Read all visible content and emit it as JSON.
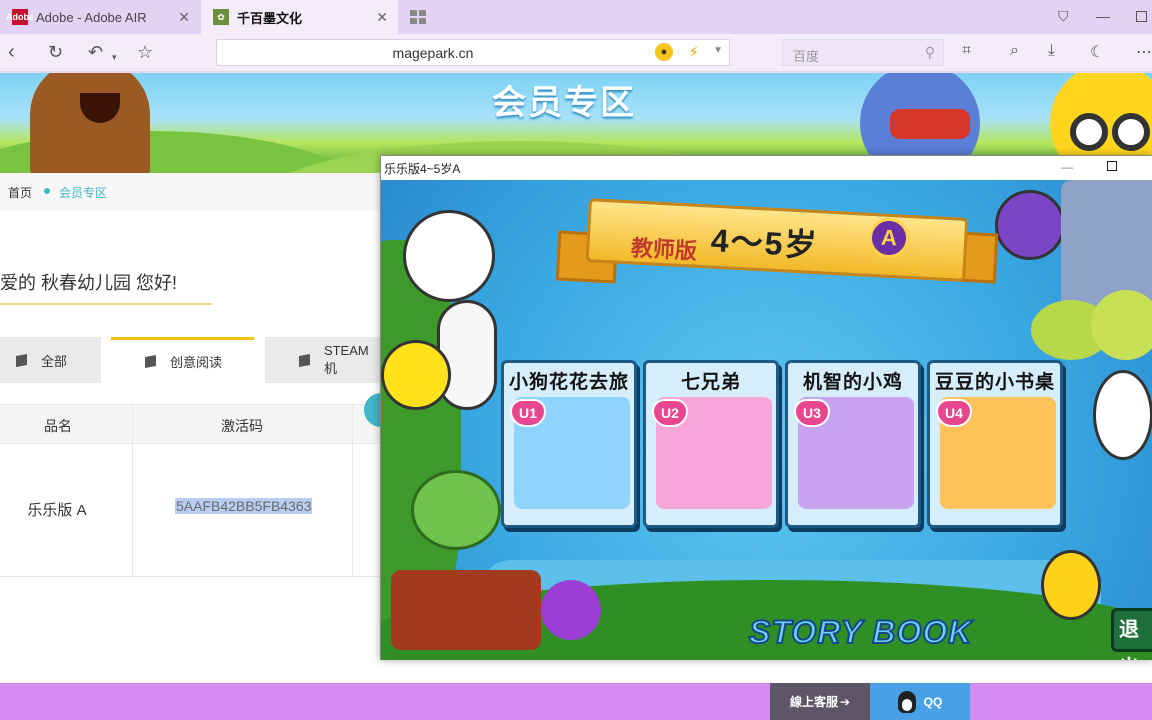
{
  "browser": {
    "tabs": [
      {
        "label": "Adobe - Adobe AIR",
        "favicon": "Adobe",
        "active": false
      },
      {
        "label": "千百墨文化",
        "favicon": "",
        "active": true
      }
    ],
    "address": "magepark.cn",
    "search_placeholder": "百度"
  },
  "site": {
    "banner_title": "会员专区",
    "breadcrumb": {
      "home": "首页",
      "current": "会员专区"
    },
    "greeting": "亲爱的 秋春幼儿园 您好!",
    "categories": [
      {
        "label": "全部",
        "active": false
      },
      {
        "label": "创意阅读",
        "active": true
      },
      {
        "label": "STEAM 机",
        "active": false
      }
    ],
    "table": {
      "headers": [
        "品名",
        "激活码"
      ],
      "rows": [
        {
          "name": "乐乐版 A",
          "code": "5AAFB42BB5FB4363"
        }
      ]
    },
    "footer": {
      "support_label": "線上客服",
      "qq_label": "QQ"
    }
  },
  "air_window": {
    "title": "乐乐版4~5岁A",
    "header": {
      "edition": "教师版",
      "age": "4～5岁",
      "level": "A"
    },
    "cards": [
      {
        "unit": "U1",
        "title": "小狗花花去旅行",
        "color": "#b8e6ff"
      },
      {
        "unit": "U2",
        "title": "七兄弟",
        "color": "#f7b6e0"
      },
      {
        "unit": "U3",
        "title": "机智的小鸡",
        "color": "#d9b3ff"
      },
      {
        "unit": "U4",
        "title": "豆豆的小书桌",
        "color": "#ffcf70"
      }
    ],
    "logo": "STORY BOOK",
    "exit_label": "退出"
  }
}
